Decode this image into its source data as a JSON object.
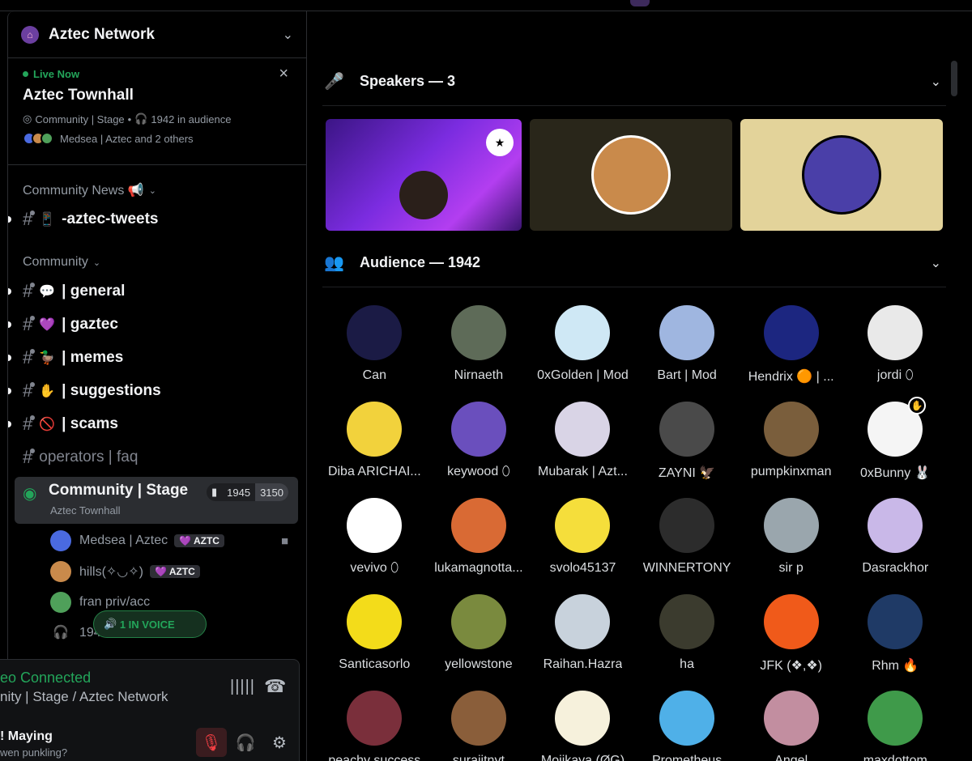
{
  "server": {
    "name": "Aztec Network",
    "icon": "server-home-icon"
  },
  "live": {
    "status": "Live Now",
    "title": "Aztec Townhall",
    "channel_label": "Community | Stage",
    "audience_label": "1942 in audience",
    "participants": "Medsea | Aztec and 2 others"
  },
  "categories": {
    "news": "Community News 📢",
    "community": "Community"
  },
  "channels": [
    {
      "emoji": "📱",
      "label": "-aztec-tweets"
    },
    {
      "emoji": "💬",
      "label": "| general"
    },
    {
      "emoji": "💜",
      "label": "| gaztec"
    },
    {
      "emoji": "🦆",
      "label": "| memes"
    },
    {
      "emoji": "✋",
      "label": "| suggestions"
    },
    {
      "emoji": "🚫",
      "label": "| scams"
    },
    {
      "emoji": "",
      "label": "operators | faq"
    }
  ],
  "stage_channel": {
    "name": "Community | Stage",
    "subtitle": "Aztec Townhall",
    "count": "1945",
    "capacity": "3150"
  },
  "voice_users": [
    {
      "name": "Medsea | Aztec",
      "tag": "AZTC"
    },
    {
      "name": "hills(✧◡✧)",
      "tag": "AZTC"
    },
    {
      "name": "fran priv/acc",
      "tag": ""
    },
    {
      "name": "194",
      "tag": ""
    }
  ],
  "in_voice_pill": "1 IN VOICE",
  "voice_panel": {
    "status": "eo Connected",
    "location": "nity | Stage / Aztec Network",
    "user": "! Maying",
    "user_status": "wen punkling?"
  },
  "speakers": {
    "title": "Speakers — 3",
    "tiles": [
      {
        "kind": "video",
        "color": "#7b2ce0",
        "badge": "moderator-shield-icon"
      },
      {
        "kind": "avatar",
        "color": "#29261a",
        "avatar": "#c98a4b"
      },
      {
        "kind": "avatar",
        "color": "#e3d39a",
        "avatar": "#4a3fa8"
      }
    ]
  },
  "audience": {
    "title": "Audience — 1942",
    "members": [
      {
        "name": "Can",
        "color": "#1b1b45"
      },
      {
        "name": "Nirnaeth",
        "color": "#5e6b58"
      },
      {
        "name": "0xGolden | Mod",
        "color": "#cfe8f5"
      },
      {
        "name": "Bart | Mod",
        "color": "#9fb6e0"
      },
      {
        "name": "Hendrix 🟠 | ...",
        "color": "#1c2680"
      },
      {
        "name": "jordi ⬯",
        "color": "#e9e9e9"
      },
      {
        "name": "Diba ARICHAI...",
        "color": "#f2d23c"
      },
      {
        "name": "keywood ⬯",
        "color": "#6a4fbd"
      },
      {
        "name": "Mubarak | Azt...",
        "color": "#d9d4e6"
      },
      {
        "name": "ZAYNI 🦅",
        "color": "#4a4a4a"
      },
      {
        "name": "pumpkinxman",
        "color": "#7a5e3c"
      },
      {
        "name": "0xBunny 🐰",
        "color": "#f5f5f5",
        "hand": true
      },
      {
        "name": "vevivo ⬯",
        "color": "#ffffff"
      },
      {
        "name": "lukamagnotta...",
        "color": "#d96a34"
      },
      {
        "name": "svolo45137",
        "color": "#f5de3b"
      },
      {
        "name": "WINNERTONY",
        "color": "#2c2c2c"
      },
      {
        "name": "sir p",
        "color": "#9aa6ad"
      },
      {
        "name": "Dasrackhor",
        "color": "#c9b8e8"
      },
      {
        "name": "Santicasorlo",
        "color": "#f3dc1a"
      },
      {
        "name": "yellowstone",
        "color": "#7a8a3e"
      },
      {
        "name": "Raihan.Hazra",
        "color": "#c8d2dc"
      },
      {
        "name": "ha",
        "color": "#3b3b2e"
      },
      {
        "name": "JFK (❖,❖)",
        "color": "#f05a1a"
      },
      {
        "name": "Rhm 🔥",
        "color": "#1f3a66"
      },
      {
        "name": "peachy success",
        "color": "#7a2f3b"
      },
      {
        "name": "surajitnyt",
        "color": "#8a5e3a"
      },
      {
        "name": "Mojikaya (ØG)",
        "color": "#f6f1dc"
      },
      {
        "name": "Prometheus",
        "color": "#4fb0e8"
      },
      {
        "name": "Angel",
        "color": "#c28ea0"
      },
      {
        "name": "maxdottom",
        "color": "#3f9a4a"
      }
    ]
  }
}
